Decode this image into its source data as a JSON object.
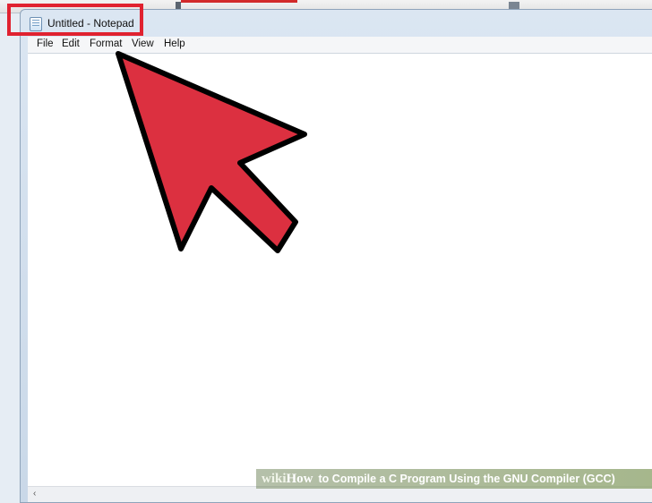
{
  "window": {
    "title": "Untitled - Notepad",
    "menu": [
      "File",
      "Edit",
      "Format",
      "View",
      "Help"
    ]
  },
  "annotation": {
    "highlight_color": "#e02230",
    "arrow_color": "#dc3040"
  },
  "banner": {
    "wiki": "wiki",
    "how": "How",
    "text": "to Compile a C Program Using the GNU Compiler (GCC)"
  },
  "scrollbar": {
    "left_arrow": "‹"
  }
}
